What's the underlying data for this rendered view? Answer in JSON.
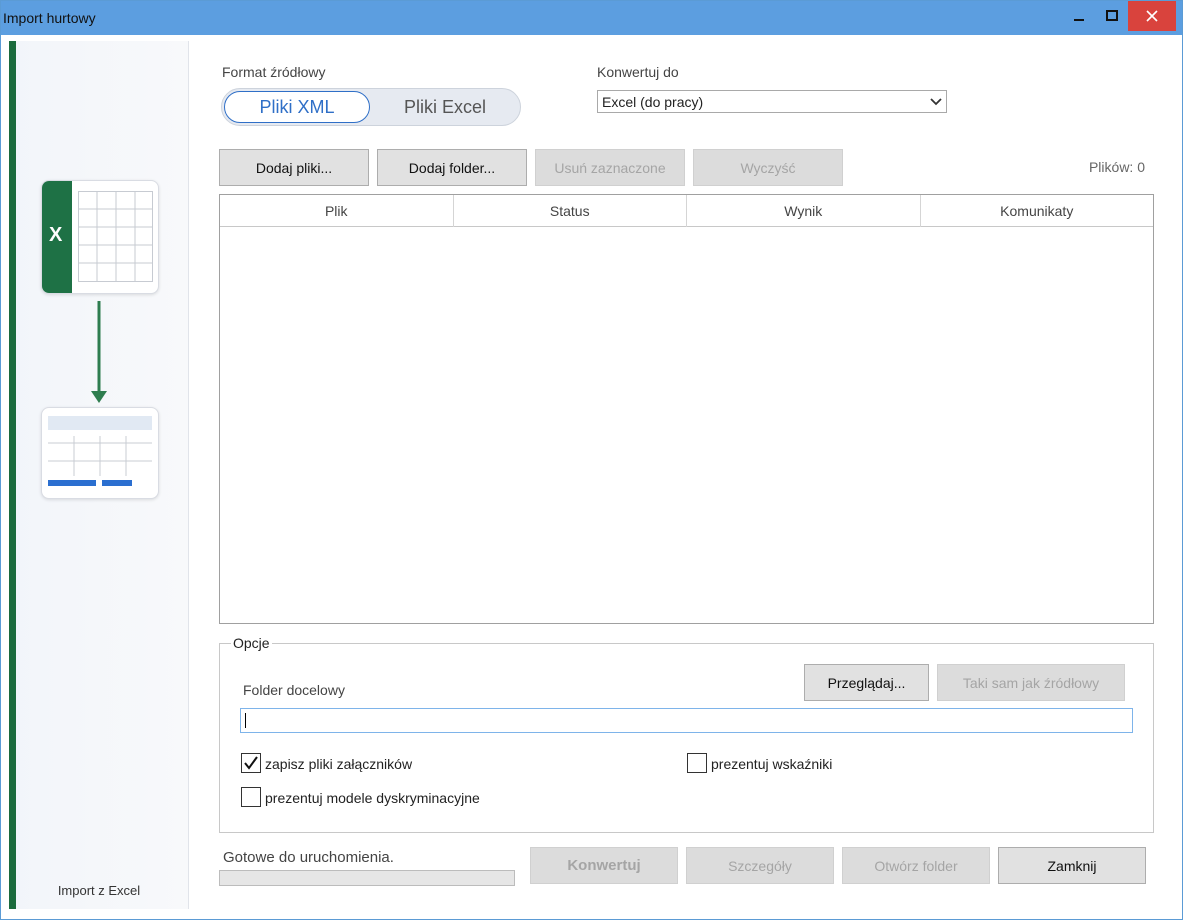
{
  "window": {
    "title": "Import hurtowy"
  },
  "sidebar": {
    "footer_label": "Import z Excel",
    "source_icon_letter": "X",
    "accent_color": "#1b6b3d"
  },
  "source_format": {
    "label": "Format źródłowy",
    "options": [
      "Pliki XML",
      "Pliki Excel"
    ],
    "selected": "Pliki XML"
  },
  "convert_to": {
    "label": "Konwertuj do",
    "selected": "Excel (do pracy)"
  },
  "toolbar": {
    "add_files": "Dodaj pliki...",
    "add_folder": "Dodaj folder...",
    "remove_selected": "Usuń zaznaczone",
    "clear": "Wyczyść",
    "file_count": "Plików: 0"
  },
  "table": {
    "columns": [
      "Plik",
      "Status",
      "Wynik",
      "Komunikaty"
    ],
    "rows": []
  },
  "options": {
    "legend": "Opcje",
    "target_folder_label": "Folder docelowy",
    "browse": "Przeglądaj...",
    "same_as_source": "Taki sam jak źródłowy",
    "target_folder_value": "",
    "checkboxes": [
      {
        "label": "zapisz pliki załączników",
        "checked": true
      },
      {
        "label": "prezentuj wskaźniki",
        "checked": false
      },
      {
        "label": "prezentuj modele dyskryminacyjne",
        "checked": false
      }
    ]
  },
  "footer": {
    "status": "Gotowe do uruchomienia.",
    "progress": 0,
    "convert": "Konwertuj",
    "details": "Szczegóły",
    "open_folder": "Otwórz folder",
    "close": "Zamknij"
  }
}
